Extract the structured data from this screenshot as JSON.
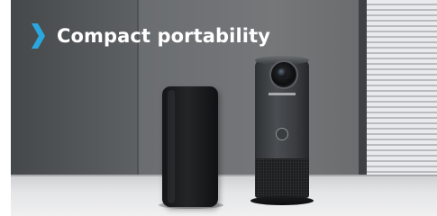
{
  "banner": {
    "title": "Compact portability",
    "accent_color": "#29a8e0",
    "icon": "chevron-right-icon"
  },
  "photo": {
    "subjects": [
      "smartphone",
      "conference-camera"
    ]
  }
}
